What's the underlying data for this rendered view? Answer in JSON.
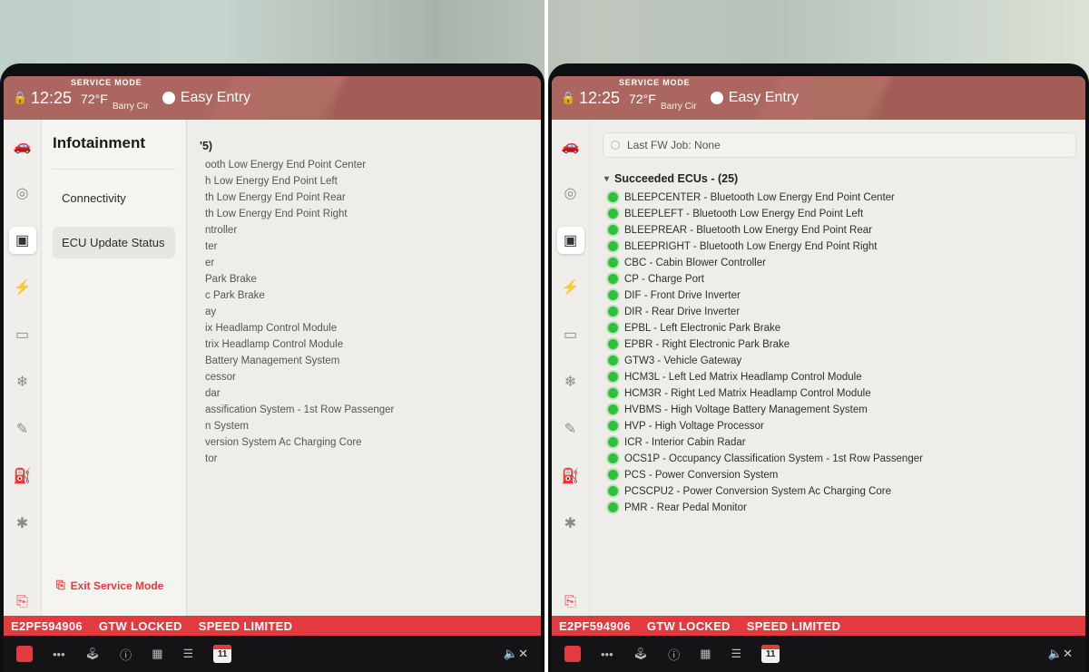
{
  "status": {
    "service_mode": "SERVICE MODE",
    "time": "12:25",
    "temp": "72°F",
    "location": "Barry Cir",
    "profile": "Easy Entry"
  },
  "rail_icons": [
    {
      "name": "car-icon",
      "glyph": "🚗",
      "interact": true
    },
    {
      "name": "steering-icon",
      "glyph": "◎",
      "interact": true
    },
    {
      "name": "chip-icon",
      "glyph": "▣",
      "interact": true,
      "active": true
    },
    {
      "name": "bolt-icon",
      "glyph": "⚡",
      "interact": true
    },
    {
      "name": "battery-icon",
      "glyph": "▭",
      "interact": true
    },
    {
      "name": "snowflake-icon",
      "glyph": "❄",
      "interact": true
    },
    {
      "name": "pencil-icon",
      "glyph": "✎",
      "interact": true
    },
    {
      "name": "fuel-icon",
      "glyph": "⛽",
      "interact": true
    },
    {
      "name": "airbag-icon",
      "glyph": "✱",
      "interact": true
    }
  ],
  "submenu": {
    "title": "Infotainment",
    "items": [
      {
        "label": "Connectivity",
        "selected": false
      },
      {
        "label": "ECU Update Status",
        "selected": true
      }
    ],
    "exit": "Exit Service Mode"
  },
  "fw_job": "Last FW Job: None",
  "section_title": "Succeeded ECUs - (25)",
  "section_title_trunc": "'5)",
  "ecus_truncated": [
    "ooth Low Energy End Point Center",
    "h Low Energy End Point Left",
    "th Low Energy End Point Rear",
    "th Low Energy End Point Right",
    "ntroller",
    "ter",
    "er",
    "Park Brake",
    "c Park Brake",
    "ay",
    "ix Headlamp Control Module",
    "trix Headlamp Control Module",
    "Battery Management System",
    "cessor",
    "dar",
    "assification System - 1st Row Passenger",
    "n System",
    "version System Ac Charging Core",
    "tor"
  ],
  "ecus_full": [
    "BLEEPCENTER - Bluetooth Low Energy End Point Center",
    "BLEEPLEFT - Bluetooth Low Energy End Point Left",
    "BLEEPREAR - Bluetooth Low Energy End Point Rear",
    "BLEEPRIGHT - Bluetooth Low Energy End Point Right",
    "CBC - Cabin Blower Controller",
    "CP - Charge Port",
    "DIF - Front Drive Inverter",
    "DIR - Rear Drive Inverter",
    "EPBL - Left Electronic Park Brake",
    "EPBR - Right Electronic Park Brake",
    "GTW3 - Vehicle Gateway",
    "HCM3L - Left Led Matrix Headlamp Control Module",
    "HCM3R - Right Led Matrix Headlamp Control Module",
    "HVBMS - High Voltage Battery Management System",
    "HVP - High Voltage Processor",
    "ICR - Interior Cabin Radar",
    "OCS1P - Occupancy Classification System - 1st Row Passenger",
    "PCS - Power Conversion System",
    "PCSCPU2 - Power Conversion System Ac Charging Core",
    "PMR - Rear Pedal Monitor"
  ],
  "alert": {
    "vin": "E2PF594906",
    "gtw": "GTW LOCKED",
    "speed": "SPEED LIMITED"
  },
  "dock": {
    "cal": "11"
  }
}
